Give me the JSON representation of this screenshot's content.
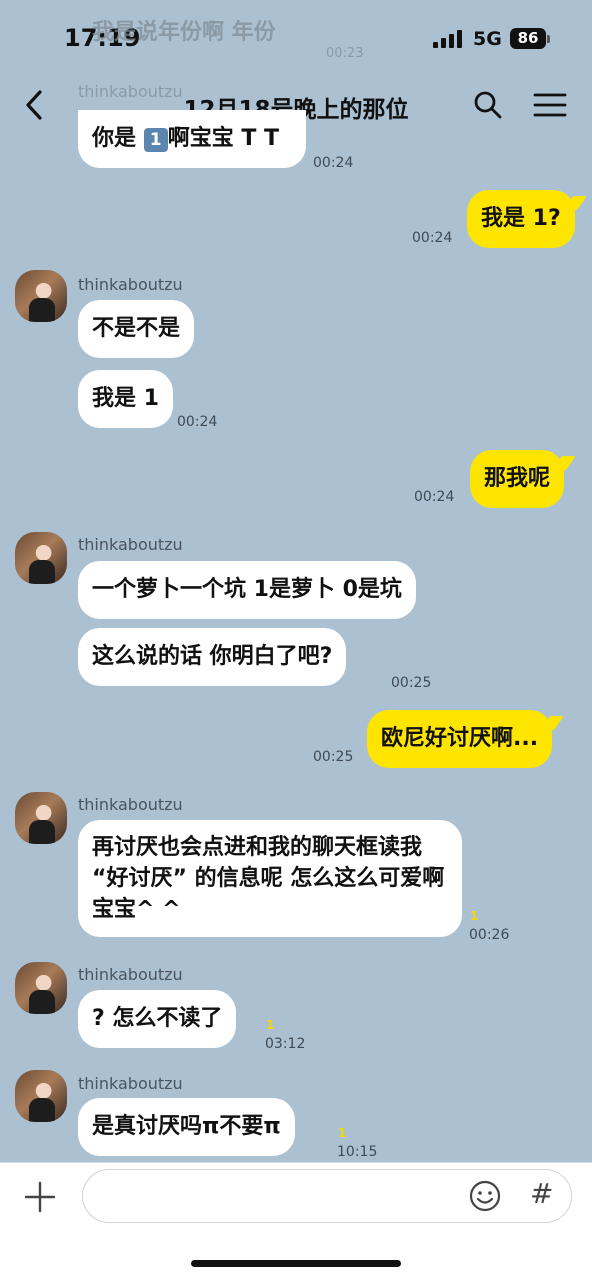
{
  "status": {
    "time": "17:19",
    "network": "5G",
    "battery": "86"
  },
  "ghost": {
    "top_text": "我是说年份啊 年份",
    "top_ts": "00:23",
    "header_name": "thinkaboutzu"
  },
  "header": {
    "title": "12月18号晚上的那位"
  },
  "messages": {
    "m0": {
      "text_a": "你是",
      "box": "1",
      "text_b": "啊宝宝 T T",
      "ts": "00:24"
    },
    "m1": {
      "text": "我是 1?",
      "ts": "00:24"
    },
    "m2": {
      "sender": "thinkaboutzu",
      "text1": "不是不是",
      "text2": "我是 1",
      "ts": "00:24"
    },
    "m3": {
      "text": "那我呢",
      "ts": "00:24"
    },
    "m4": {
      "sender": "thinkaboutzu",
      "text1": "一个萝卜一个坑 1是萝卜 0是坑",
      "text2": "这么说的话 你明白了吧?",
      "ts": "00:25"
    },
    "m5": {
      "text": "欧尼好讨厌啊...",
      "ts": "00:25"
    },
    "m6": {
      "sender": "thinkaboutzu",
      "text": "再讨厌也会点进和我的聊天框读我 “好讨厌” 的信息呢 怎么这么可爱啊宝宝^ ^",
      "unread": "1",
      "ts": "00:26"
    },
    "m7": {
      "sender": "thinkaboutzu",
      "text": "? 怎么不读了",
      "unread": "1",
      "ts": "03:12"
    },
    "m8": {
      "sender": "thinkaboutzu",
      "text": "是真讨厌吗π不要π",
      "unread": "1",
      "ts": "10:15"
    }
  },
  "input": {
    "placeholder": ""
  },
  "icons": [
    "back-icon",
    "search-icon",
    "menu-icon",
    "plus-icon",
    "emoji-icon",
    "hash-icon"
  ],
  "colors": {
    "background": "#abc1d1",
    "my_bubble": "#fee500",
    "their_bubble": "#ffffff"
  }
}
